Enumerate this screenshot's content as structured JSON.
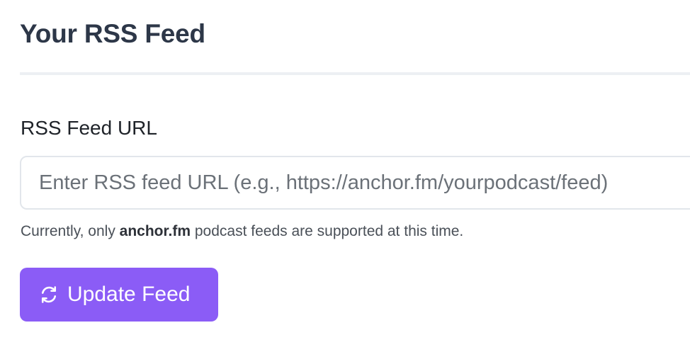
{
  "header": {
    "title": "Your RSS Feed"
  },
  "form": {
    "label": "RSS Feed URL",
    "input_value": "",
    "input_placeholder": "Enter RSS feed URL (e.g., https://anchor.fm/yourpodcast/feed)",
    "help_prefix": "Currently, only ",
    "help_emphasis": "anchor.fm",
    "help_suffix": " podcast feeds are supported at this time.",
    "button_label": "Update Feed",
    "button_icon": "refresh-icon"
  },
  "colors": {
    "accent": "#8b5cf6",
    "title": "#2d3748"
  }
}
